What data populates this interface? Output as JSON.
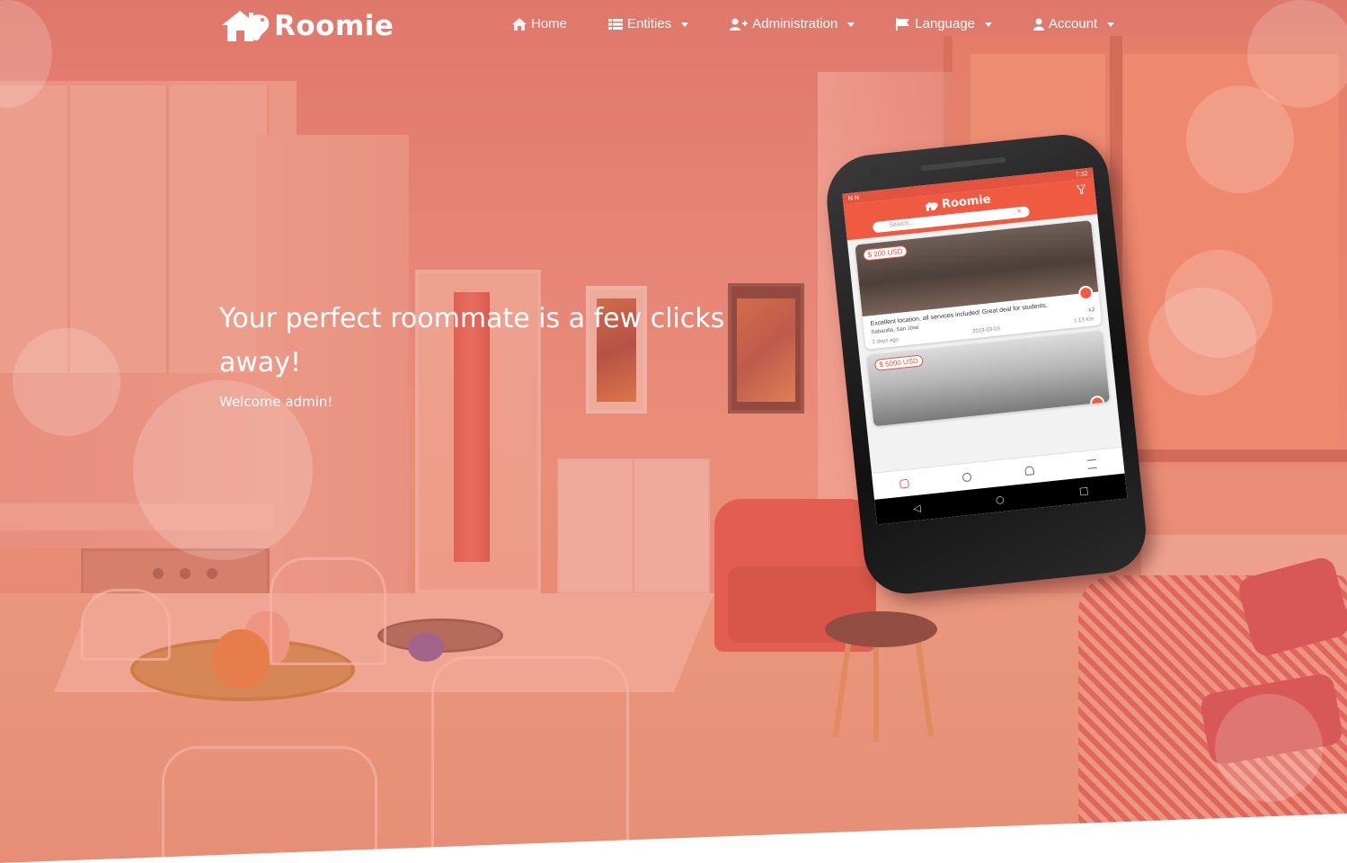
{
  "brand": {
    "name": "Roomie"
  },
  "nav": {
    "home": "Home",
    "entities": "Entities",
    "administration": "Administration",
    "language": "Language",
    "account": "Account"
  },
  "hero": {
    "headline": "Your perfect roommate is a few clicks away!",
    "welcome": "Welcome admin!"
  },
  "phone": {
    "app_title": "Roomie",
    "search_placeholder": "Search...",
    "status_time": "7:32",
    "listings": [
      {
        "price": "$ 200 USD",
        "title": "Excellent location, all services included! Great deal for students,",
        "location": "Sabanilla, San Jose",
        "posted": "2 days ago",
        "date": "2019-03-03",
        "distance": "1.13 Km",
        "count": "x2"
      },
      {
        "price": "$ 5000 USD"
      }
    ]
  },
  "colors": {
    "accent": "#ef5a41",
    "overlay": "#e86e5a"
  }
}
